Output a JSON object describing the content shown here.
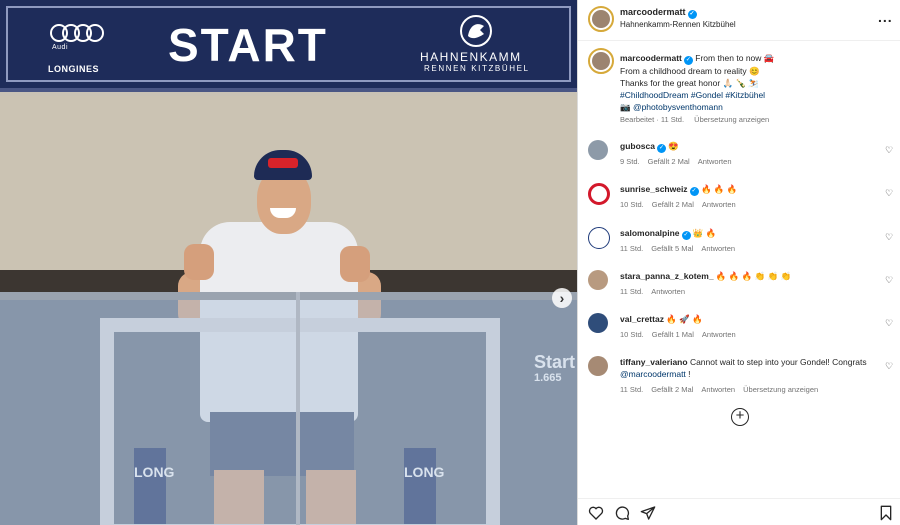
{
  "photo": {
    "banner_brand": "Audi",
    "banner_sponsor": "LONGINES",
    "banner_main": "START",
    "banner_event_title": "HAHNENKAMM",
    "banner_event_sub": "RENNEN KITZBÜHEL",
    "gate_text": "LONG",
    "start_small": "Start",
    "start_altitude": "1.665"
  },
  "header": {
    "username": "marcoodermatt",
    "location": "Hahnenkamm-Rennen Kitzbühel",
    "more_label": "..."
  },
  "caption": {
    "username": "marcoodermatt",
    "line1": "From then to now 🚘",
    "line2": "From a childhood dream to reality 😊",
    "line3": "Thanks for the great honor 🙏🏻 🍾 ⛷️",
    "hashtags": "#ChildhoodDream #Gondel #Kitzbühel",
    "credit": "📷 @photobysventhomann",
    "meta_edited": "Bearbeitet · 11 Std.",
    "meta_translate": "Übersetzung anzeigen"
  },
  "comments": [
    {
      "user": "gubosca",
      "text": "😍",
      "time": "9 Std.",
      "likes": "Gefällt 2 Mal",
      "reply": "Antworten",
      "extra": ""
    },
    {
      "user": "sunrise_schweiz",
      "text": "🔥 🔥 🔥",
      "time": "10 Std.",
      "likes": "Gefällt 2 Mal",
      "reply": "Antworten",
      "extra": ""
    },
    {
      "user": "salomonalpine",
      "text": "👑 🔥",
      "time": "11 Std.",
      "likes": "Gefällt 5 Mal",
      "reply": "Antworten",
      "extra": ""
    },
    {
      "user": "stara_panna_z_kotem_",
      "text": "🔥 🔥 🔥 👏 👏 👏",
      "time": "11 Std.",
      "likes": "",
      "reply": "Antworten",
      "extra": ""
    },
    {
      "user": "val_crettaz",
      "text": "🔥 🚀 🔥",
      "time": "10 Std.",
      "likes": "Gefällt 1 Mal",
      "reply": "Antworten",
      "extra": ""
    },
    {
      "user": "tiffany_valeriano",
      "text": "Cannot wait to step into your Gondel! Congrats",
      "mention": "@marcoodermatt",
      "tail": " !",
      "time": "11 Std.",
      "likes": "Gefällt 2 Mal",
      "reply": "Antworten",
      "extra": "Übersetzung anzeigen"
    }
  ],
  "colors": {
    "verified": "#0095f6",
    "link": "#00376b",
    "meta": "#737373"
  }
}
